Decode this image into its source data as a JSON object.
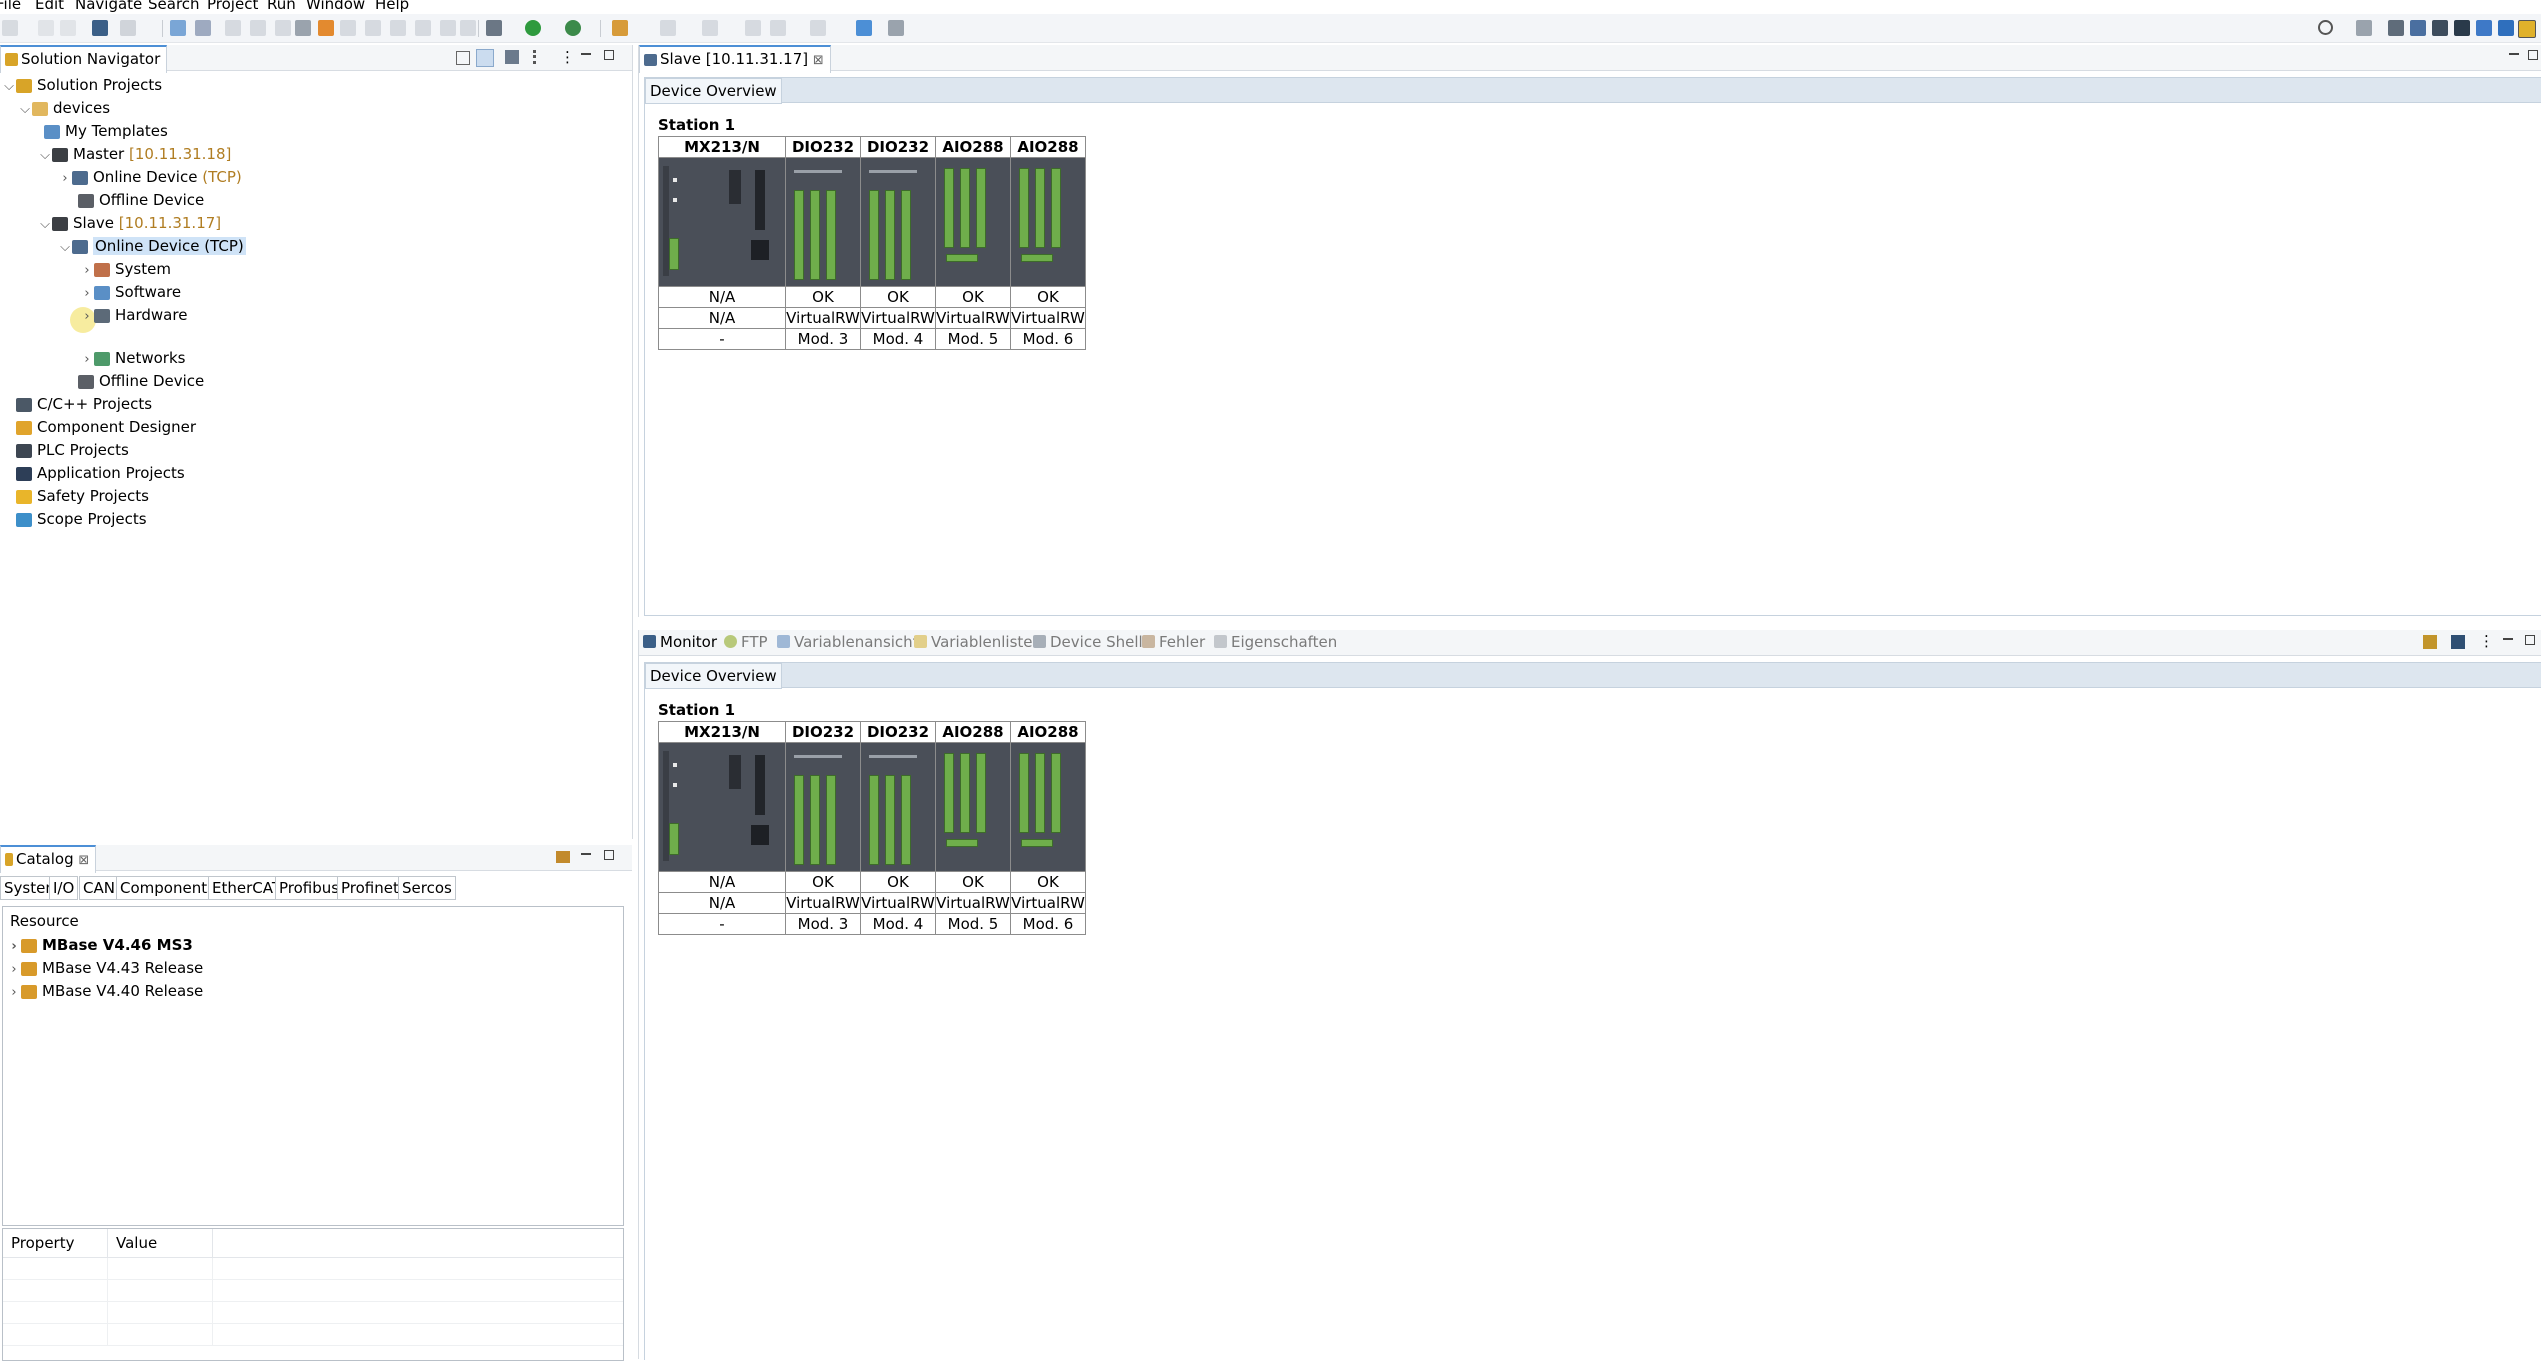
{
  "menu": [
    "File",
    "Edit",
    "Navigate",
    "Search",
    "Project",
    "Run",
    "Window",
    "Help"
  ],
  "navigator": {
    "title": "Solution Navigator",
    "tree": [
      {
        "label": "Solution Projects",
        "icon": "solution-icon"
      },
      {
        "label": "devices",
        "icon": "folder-icon"
      },
      {
        "label": "My Templates",
        "icon": "templates-icon"
      },
      {
        "label": "Master",
        "ip": "[10.11.31.18]",
        "icon": "device-icon"
      },
      {
        "label": "Online Device",
        "ip": "(TCP)",
        "icon": "online-device-icon"
      },
      {
        "label": "Offline Device",
        "icon": "offline-device-icon"
      },
      {
        "label": "Slave",
        "ip": "[10.11.31.17]",
        "icon": "device-icon"
      },
      {
        "label": "Online Device (TCP)",
        "icon": "online-device-icon"
      },
      {
        "label": "System",
        "icon": "system-icon"
      },
      {
        "label": "Software",
        "icon": "software-icon"
      },
      {
        "label": "Hardware",
        "icon": "hardware-icon"
      },
      {
        "label": "Networks",
        "icon": "network-icon"
      },
      {
        "label": "Offline Device",
        "icon": "offline-device-icon"
      },
      {
        "label": "C/C++ Projects",
        "icon": "cpp-icon"
      },
      {
        "label": "Component Designer",
        "icon": "component-icon"
      },
      {
        "label": "PLC Projects",
        "icon": "plc-icon"
      },
      {
        "label": "Application Projects",
        "icon": "application-icon"
      },
      {
        "label": "Safety Projects",
        "icon": "safety-icon"
      },
      {
        "label": "Scope Projects",
        "icon": "scope-icon"
      }
    ]
  },
  "catalog": {
    "title": "Catalog",
    "tabs": [
      "System",
      "I/O",
      "CAN",
      "Components",
      "EtherCAT",
      "Profibus",
      "Profinet",
      "Sercos"
    ],
    "resource_header": "Resource",
    "resources": [
      "MBase V4.46 MS3",
      "MBase V4.43 Release",
      "MBase V4.40 Release"
    ],
    "property_header": "Property",
    "value_header": "Value"
  },
  "editor": {
    "tab_title": "Slave [10.11.31.17]",
    "overview_label": "Device Overview",
    "station": "Station 1"
  },
  "bottom": {
    "tabs": [
      "Monitor",
      "FTP",
      "Variablenansicht",
      "Variablenliste",
      "Device Shell",
      "Fehler",
      "Eigenschaften"
    ],
    "overview_label": "Device Overview",
    "station": "Station 1"
  },
  "modules": [
    {
      "name": "MX213/N",
      "status": "N/A",
      "type": "N/A",
      "slot": "-"
    },
    {
      "name": "DIO232",
      "status": "OK",
      "type": "VirtualRW",
      "slot": "Mod. 3"
    },
    {
      "name": "DIO232",
      "status": "OK",
      "type": "VirtualRW",
      "slot": "Mod. 4"
    },
    {
      "name": "AIO288",
      "status": "OK",
      "type": "VirtualRW",
      "slot": "Mod. 5"
    },
    {
      "name": "AIO288",
      "status": "OK",
      "type": "VirtualRW",
      "slot": "Mod. 6"
    }
  ],
  "colors": {
    "accent": "#4c8fd6",
    "ip": "#b07d22",
    "selection": "#cfe3f7",
    "terminal_green": "#6fae4b"
  }
}
